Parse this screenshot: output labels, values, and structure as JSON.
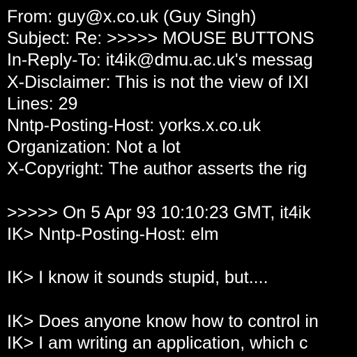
{
  "document": {
    "lines": [
      "From: guy@x.co.uk (Guy Singh)",
      "Subject: Re: >>>>> MOUSE BUTTONS",
      "In-Reply-To: it4ik@dmu.ac.uk's messag",
      "X-Disclaimer: This is not the view of IXI",
      "Lines: 29",
      "Nntp-Posting-Host: yorks.x.co.uk",
      "Organization: Not a lot",
      "X-Copyright: The author asserts the rig",
      "",
      ">>>>> On 5 Apr 93 10:10:23 GMT, it4ik",
      "IK> Nntp-Posting-Host: elm",
      "",
      "IK> I know it sounds stupid, but....",
      "",
      "IK> Does anyone know how to control in",
      "IK> I am writing an application, which c"
    ],
    "colors": {
      "background": "#000000",
      "text": "#ffffff"
    }
  }
}
